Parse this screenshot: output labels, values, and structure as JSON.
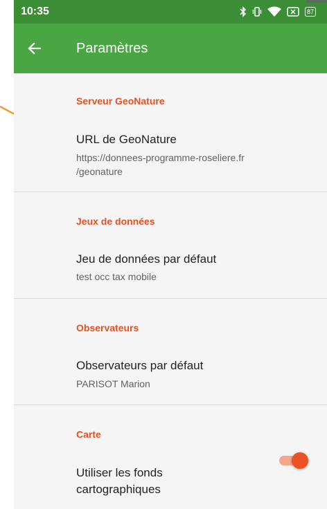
{
  "status_bar": {
    "time": "10:35",
    "battery": "87"
  },
  "app_bar": {
    "title": "Paramètres"
  },
  "sections": [
    {
      "header": "Serveur GeoNature",
      "title": "URL de GeoNature",
      "summary_line1": "https://donnees-programme-roseliere.fr",
      "summary_line2": "/geonature"
    },
    {
      "header": "Jeux de données",
      "title": "Jeu de données par défaut",
      "summary": "test occ tax mobile"
    },
    {
      "header": "Observateurs",
      "title": "Observateurs par défaut",
      "summary": "PARISOT Marion"
    },
    {
      "header": "Carte",
      "title_line1": "Utiliser les fonds",
      "title_line2": "cartographiques",
      "toggle_on": true
    }
  ],
  "colors": {
    "status_bar": "#3b8e35",
    "app_bar": "#4aa543",
    "accent": "#e8501e",
    "annotation_arrow": "#f39a36",
    "toggle_thumb": "#ec5324"
  },
  "icons": [
    "back-arrow-icon",
    "bluetooth-icon",
    "vibrate-icon",
    "wifi-icon",
    "no-sim-icon",
    "battery-icon"
  ]
}
